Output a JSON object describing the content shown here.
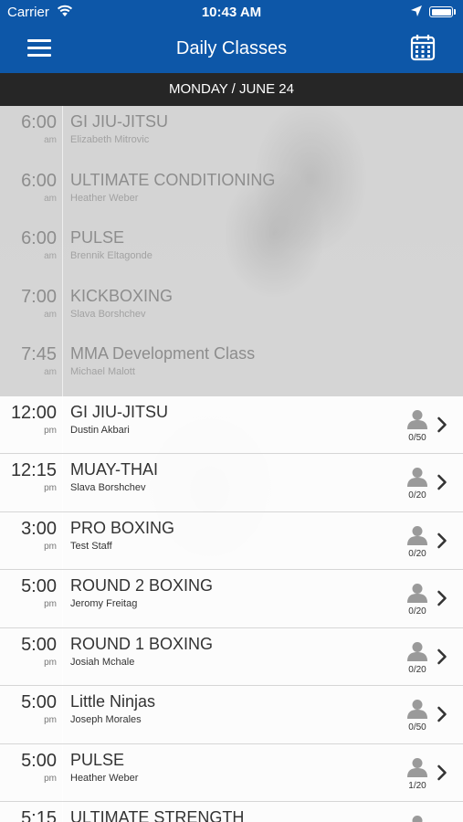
{
  "status_bar": {
    "carrier": "Carrier",
    "time": "10:43 AM"
  },
  "nav": {
    "title": "Daily Classes"
  },
  "date_header": "MONDAY / JUNE 24",
  "past_classes": [
    {
      "time": "6:00",
      "ampm": "am",
      "name": "GI JIU-JITSU",
      "instructor": "Elizabeth Mitrovic"
    },
    {
      "time": "6:00",
      "ampm": "am",
      "name": "ULTIMATE CONDITIONING",
      "instructor": "Heather Weber"
    },
    {
      "time": "6:00",
      "ampm": "am",
      "name": "PULSE",
      "instructor": "Brennik Eltagonde"
    },
    {
      "time": "7:00",
      "ampm": "am",
      "name": "KICKBOXING",
      "instructor": "Slava Borshchev"
    },
    {
      "time": "7:45",
      "ampm": "am",
      "name": "MMA Development Class",
      "instructor": "Michael Malott"
    }
  ],
  "upcoming_classes": [
    {
      "time": "12:00",
      "ampm": "pm",
      "name": "GI JIU-JITSU",
      "instructor": "Dustin Akbari",
      "capacity": "0/50"
    },
    {
      "time": "12:15",
      "ampm": "pm",
      "name": "MUAY-THAI",
      "instructor": "Slava Borshchev",
      "capacity": "0/20"
    },
    {
      "time": "3:00",
      "ampm": "pm",
      "name": "PRO BOXING",
      "instructor": "Test Staff",
      "capacity": "0/20"
    },
    {
      "time": "5:00",
      "ampm": "pm",
      "name": "ROUND 2 BOXING",
      "instructor": "Jeromy Freitag",
      "capacity": "0/20"
    },
    {
      "time": "5:00",
      "ampm": "pm",
      "name": "ROUND 1 BOXING",
      "instructor": "Josiah Mchale",
      "capacity": "0/20"
    },
    {
      "time": "5:00",
      "ampm": "pm",
      "name": "Little Ninjas",
      "instructor": "Joseph Morales",
      "capacity": "0/50"
    },
    {
      "time": "5:00",
      "ampm": "pm",
      "name": "PULSE",
      "instructor": "Heather Weber",
      "capacity": "1/20"
    },
    {
      "time": "5:15",
      "ampm": "",
      "name": "ULTIMATE STRENGTH",
      "instructor": "",
      "capacity": ""
    }
  ],
  "icons": {
    "menu": "hamburger-menu-icon",
    "calendar": "calendar-icon",
    "wifi": "wifi-icon",
    "location": "location-arrow-icon",
    "battery": "battery-icon",
    "person": "person-icon",
    "chevron": "chevron-right-icon"
  },
  "colors": {
    "brand_blue": "#0d57a8",
    "date_bar": "#262626"
  }
}
